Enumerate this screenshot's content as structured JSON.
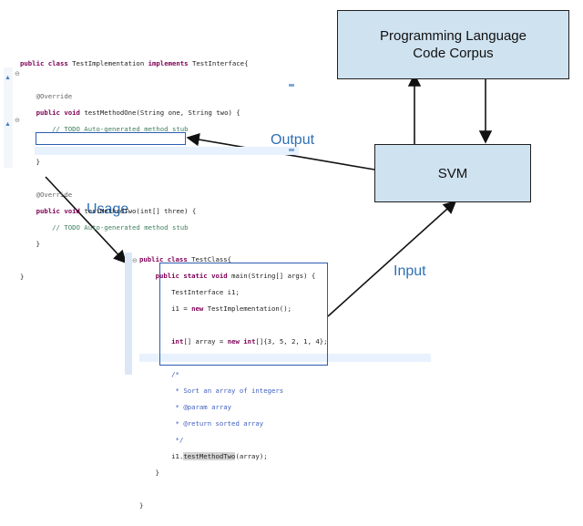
{
  "boxes": {
    "corpus": {
      "line1": "Programming Language",
      "line2": "Code Corpus"
    },
    "svm": "SVM"
  },
  "labels": {
    "output": "Output",
    "usage": "Usage",
    "input": "Input"
  },
  "colors": {
    "box_fill": "#cfe2f0",
    "label_text": "#2e6fb5",
    "highlight_box": "#2a5db0"
  },
  "top_code": {
    "class_kw1": "public",
    "class_kw2": "class",
    "class_name": "TestImplementation",
    "implements_kw": "implements",
    "interface_name": "TestInterface{",
    "override1": "@Override",
    "m1_kw": "public void",
    "m1_sig": "testMethodOne(String one, String two) {",
    "m1_todo": "// TODO Auto-generated method stub",
    "m1_close": "}",
    "override2": "@Override",
    "m2_kw": "public void",
    "m2_sig": "testMethodTwo(int[] three) {",
    "m2_todo": "// TODO Auto-generated method stub",
    "m2_close": "}",
    "class_close": "}"
  },
  "bottom_code": {
    "class_line_kw": "public class",
    "class_line_name": "TestClass{",
    "main_kw": "public static void",
    "main_sig": "main(String[] args) {",
    "l1": "TestInterface i1;",
    "l2a": "i1 =",
    "l2kw": "new",
    "l2b": "TestImplementation();",
    "l3a": "int",
    "l3b": "[] array =",
    "l3kw": "new",
    "l3c": "int",
    "l3d": "[]{3, 5, 2, 1, 4};",
    "jd1": "/*",
    "jd2": " * Sort an array of integers",
    "jd3": " * @param array",
    "jd4": " * @return sorted array",
    "jd5": " */",
    "call_a": "i1.",
    "call_b": "testMethodTwo",
    "call_c": "(array);",
    "main_close": "}",
    "class_close": "}"
  }
}
